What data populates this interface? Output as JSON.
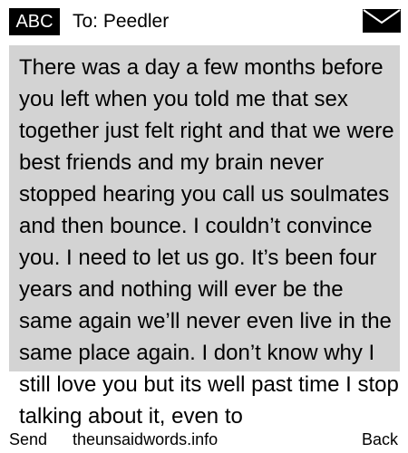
{
  "header": {
    "mode_label": "ABC",
    "recipient": "To: Peedler"
  },
  "message": {
    "body": "There was a day a few months before you left when you told me that sex together just felt right and that we were best friends and my brain never stopped hearing you call us soulmates and then bounce. I couldn’t convince you. I need to let us go. It’s been four years and nothing will ever be the same again we’ll never even live in the same place again. I don’t know why I still love you but its well past time I stop talking about it, even to"
  },
  "footer": {
    "left_label": "Send",
    "center_label": "theunsaidwords.info",
    "right_label": "Back"
  },
  "icons": {
    "mail": "envelope-icon"
  },
  "colors": {
    "badge_background": "#000000",
    "message_background": "#d3d3d3",
    "text": "#000000",
    "page_background": "#ffffff"
  }
}
